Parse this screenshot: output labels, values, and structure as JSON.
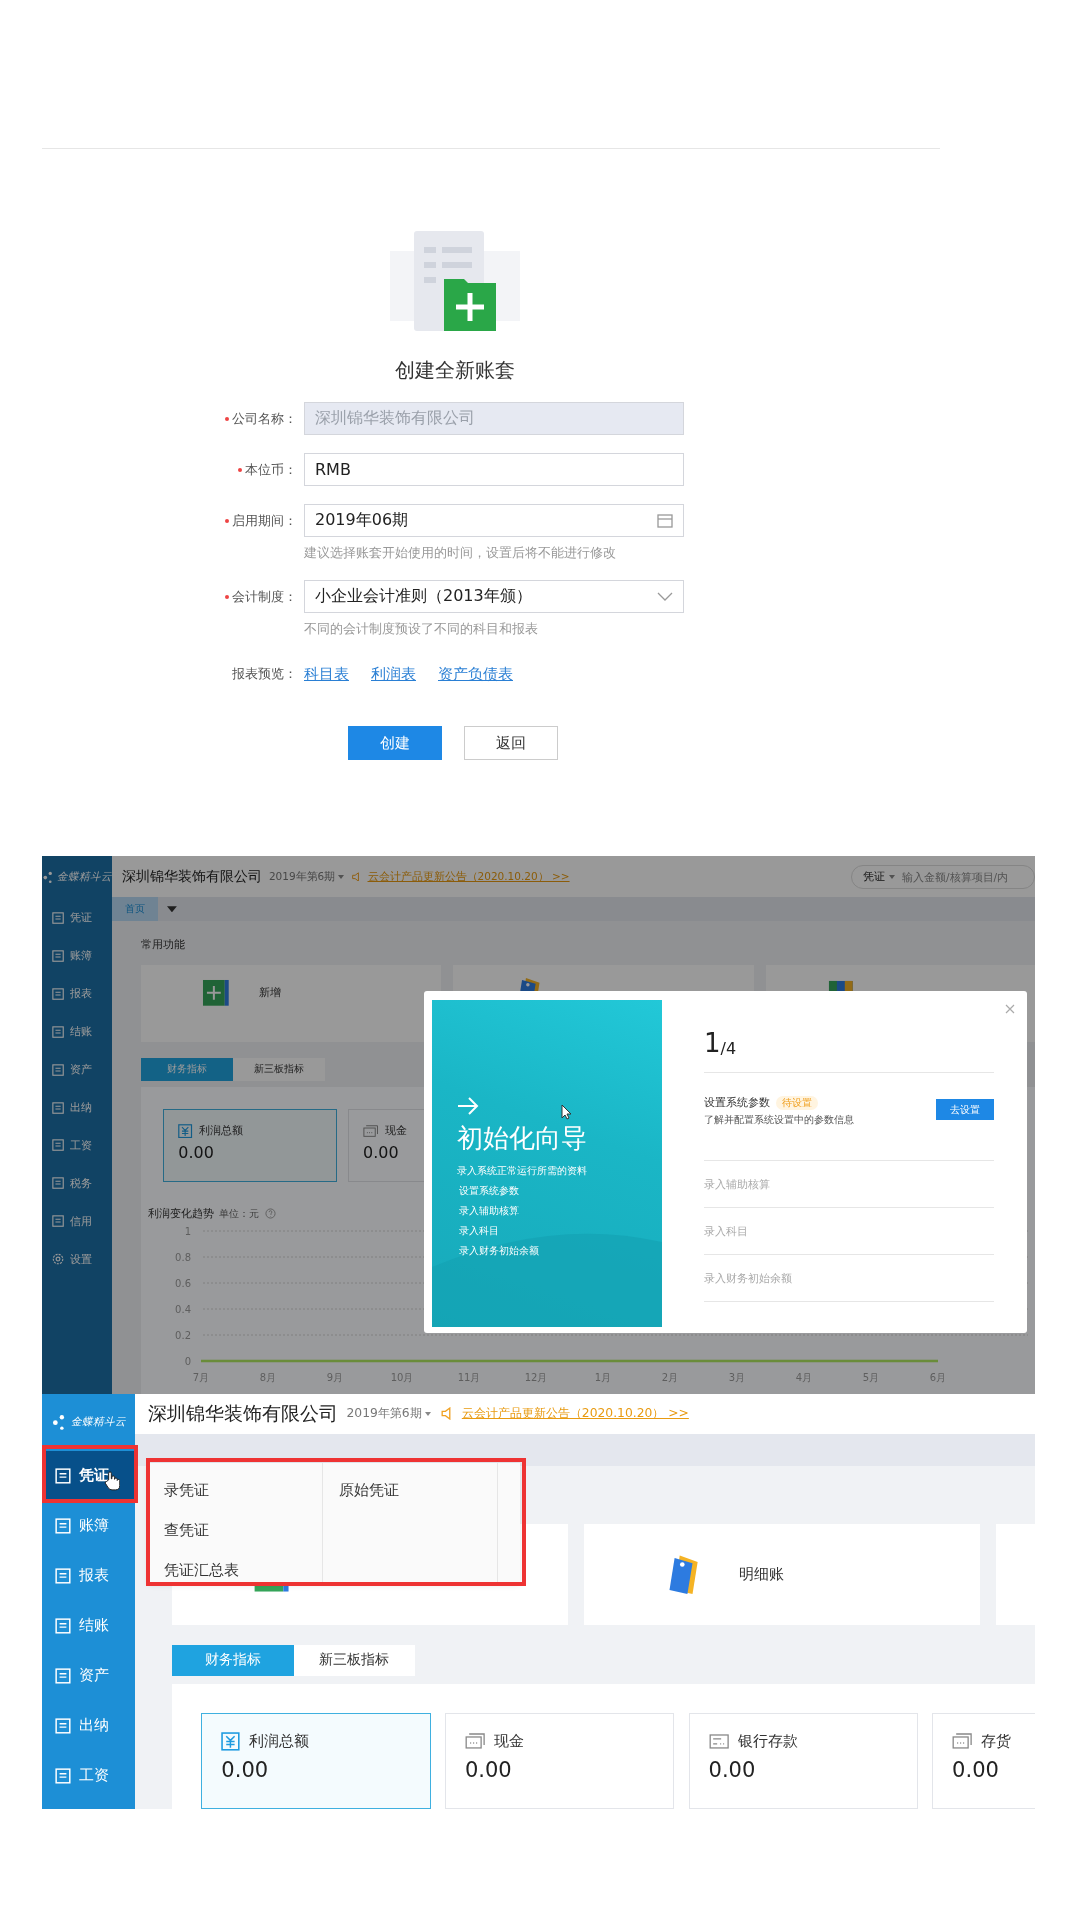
{
  "create_form": {
    "title": "创建全新账套",
    "fields": [
      {
        "label": "公司名称：",
        "required": true,
        "kind": "text",
        "value": "深圳锦华装饰有限公司",
        "disabled": true
      },
      {
        "label": "本位币：",
        "required": true,
        "kind": "text",
        "value": "RMB",
        "disabled": false
      },
      {
        "label": "启用期间：",
        "required": true,
        "kind": "date",
        "value": "2019年06期",
        "disabled": false,
        "hint": "建议选择账套开始使用的时间，设置后将不能进行修改"
      },
      {
        "label": "会计制度：",
        "required": true,
        "kind": "select",
        "value": "小企业会计准则（2013年颁）",
        "disabled": false,
        "hint": "不同的会计制度预设了不同的科目和报表"
      }
    ],
    "preview": {
      "label": "报表预览：",
      "links": [
        "科目表",
        "利润表",
        "资产负债表"
      ]
    },
    "buttons": [
      {
        "label": "创建",
        "kind": "primary"
      },
      {
        "label": "返回",
        "kind": "default"
      }
    ]
  },
  "home_with_wizard": {
    "logo": "金蝶精斗云",
    "company": "深圳锦华装饰有限公司",
    "period": "2019年第6期",
    "notice": "云会计产品更新公告（2020.10.20） >>",
    "voucher_menu": "凭证",
    "search_placeholder": "输入金额/核算项目/内",
    "sidebar": [
      {
        "label": "凭证",
        "kind": "nav",
        "selected": false
      },
      {
        "label": "账簿",
        "kind": "nav",
        "selected": false
      },
      {
        "label": "报表",
        "kind": "nav",
        "selected": false
      },
      {
        "label": "结账",
        "kind": "nav",
        "selected": false
      },
      {
        "label": "资产",
        "kind": "nav",
        "selected": false
      },
      {
        "label": "出纳",
        "kind": "nav",
        "selected": false
      },
      {
        "label": "工资",
        "kind": "nav",
        "selected": false
      },
      {
        "label": "税务",
        "kind": "nav",
        "selected": false
      },
      {
        "label": "信用",
        "kind": "nav",
        "selected": false
      },
      {
        "label": "设置",
        "kind": "settings",
        "selected": false
      }
    ],
    "tabs": [
      {
        "label": "首页",
        "selected": true
      }
    ],
    "section_title": "常用功能",
    "shortcuts": [
      {
        "kind": "add",
        "label": "新增"
      },
      {
        "kind": "ledger"
      },
      {
        "kind": "report"
      }
    ],
    "indicator_tabs": [
      {
        "label": "财务指标",
        "selected": true
      },
      {
        "label": "新三板指标",
        "selected": false
      }
    ],
    "indicators": [
      {
        "kind": "profit",
        "label": "利润总额",
        "value": "0.00",
        "selected": true
      },
      {
        "kind": "cash",
        "label": "现金",
        "value": "0.00",
        "selected": false
      }
    ],
    "chart": {
      "title": "利润变化趋势",
      "unit": "单位：元",
      "chart_data": {
        "type": "line",
        "categories": [
          "7月",
          "8月",
          "9月",
          "10月",
          "11月",
          "12月",
          "1月",
          "2月",
          "3月",
          "4月",
          "5月",
          "6月"
        ],
        "series": [
          {
            "color": "#6a8c3a",
            "values": [
              0,
              0,
              0,
              0,
              0,
              0,
              0,
              0,
              0,
              0,
              0,
              0
            ]
          }
        ],
        "ylim": [
          0,
          1
        ],
        "yticks": [
          0,
          0.2,
          0.4,
          0.6,
          0.8,
          1
        ],
        "grid": true
      }
    },
    "wizard": {
      "title": "初始化向导",
      "subtitle": "录入系统正常运行所需的资料",
      "bullets": [
        "设置系统参数",
        "录入辅助核算",
        "录入科目",
        "录入财务初始余额"
      ],
      "step_current": "1",
      "step_total": "/4",
      "steps": [
        {
          "label": "设置系统参数",
          "badge": "待设置",
          "description": "了解并配置系统设置中的参数信息",
          "button": "去设置",
          "active": true
        },
        {
          "label": "录入辅助核算",
          "active": false
        },
        {
          "label": "录入科目",
          "active": false
        },
        {
          "label": "录入财务初始余额",
          "active": false
        }
      ]
    }
  },
  "home_with_menu": {
    "logo": "金蝶精斗云",
    "company": "深圳锦华装饰有限公司",
    "period": "2019年第6期",
    "notice": "云会计产品更新公告（2020.10.20） >>",
    "sidebar": [
      {
        "label": "凭证",
        "kind": "nav",
        "selected": true
      },
      {
        "label": "账簿",
        "kind": "nav",
        "selected": false
      },
      {
        "label": "报表",
        "kind": "nav",
        "selected": false
      },
      {
        "label": "结账",
        "kind": "nav",
        "selected": false
      },
      {
        "label": "资产",
        "kind": "nav",
        "selected": false
      },
      {
        "label": "出纳",
        "kind": "nav",
        "selected": false
      },
      {
        "label": "工资",
        "kind": "nav",
        "selected": false
      }
    ],
    "shortcuts": [
      {
        "kind": "add"
      },
      {
        "kind": "ledger",
        "label": "明细账"
      },
      {
        "kind": "plain"
      }
    ],
    "indicator_tabs": [
      {
        "label": "财务指标",
        "selected": true
      },
      {
        "label": "新三板指标",
        "selected": false
      }
    ],
    "indicators": [
      {
        "kind": "profit",
        "label": "利润总额",
        "value": "0.00",
        "selected": true
      },
      {
        "kind": "cash",
        "label": "现金",
        "value": "0.00",
        "selected": false
      },
      {
        "kind": "bank",
        "label": "银行存款",
        "value": "0.00",
        "selected": false
      },
      {
        "kind": "cash",
        "label": "存货",
        "value": "0.00",
        "selected": false
      }
    ],
    "menu": {
      "columns": [
        [
          "录凭证",
          "查凭证",
          "凭证汇总表"
        ],
        [
          "原始凭证"
        ]
      ]
    }
  }
}
